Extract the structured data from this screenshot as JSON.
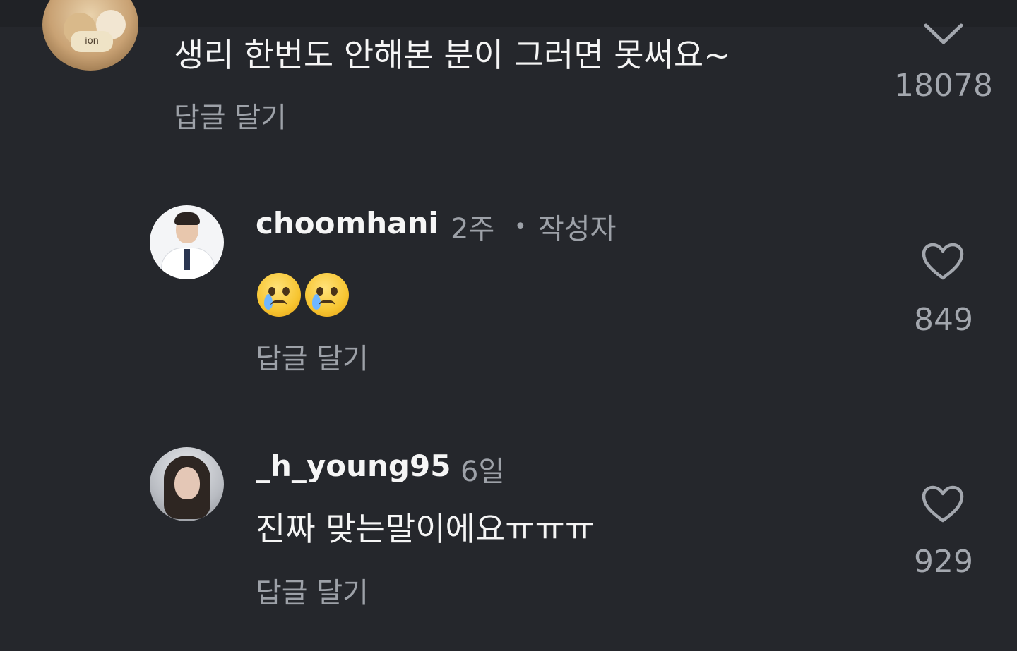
{
  "comments": [
    {
      "text": "생리 한번도 안해본 분이 그러면 못써요~",
      "reply_label": "답글 달기",
      "like_count": "18078",
      "avatar_label": "ion"
    },
    {
      "username": "choomhani",
      "time": "2주",
      "separator": "•",
      "badge": "작성자",
      "text_emoji": "😢😢",
      "reply_label": "답글 달기",
      "like_count": "849"
    },
    {
      "username": "_h_young95",
      "time": "6일",
      "text": "진짜 맞는말이에요ㅠㅠㅠ",
      "reply_label": "답글 달기",
      "like_count": "929"
    }
  ],
  "icons": {
    "like": "heart-outline-icon",
    "top_partial": "chevron-down-icon"
  },
  "colors": {
    "background": "#25272c",
    "primary_text": "#f5f5f5",
    "secondary_text": "#9da1a8"
  }
}
